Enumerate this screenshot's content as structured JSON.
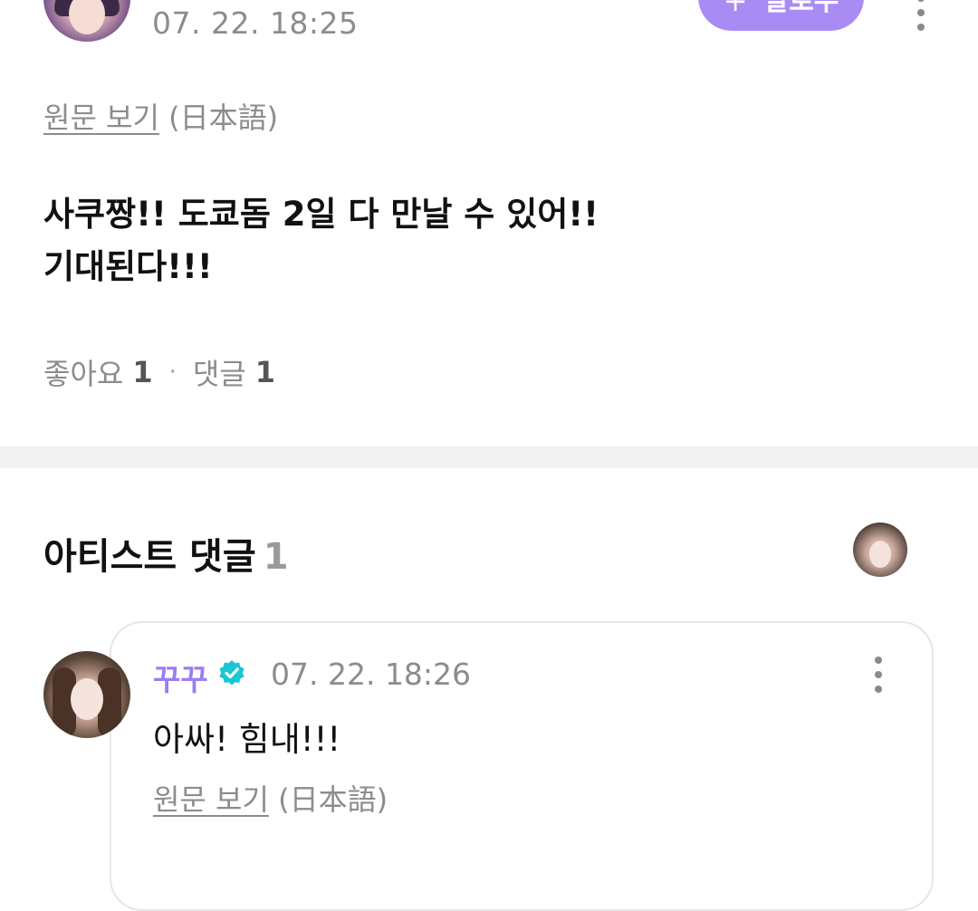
{
  "post": {
    "timestamp": "07. 22. 18:25",
    "follow_label": "팔로우",
    "follow_icon": "+",
    "view_original_label": "원문 보기",
    "original_language": "(日本語)",
    "body": "사쿠짱!! 도쿄돔 2일 다 만날 수 있어!!\n기대된다!!!",
    "likes_label": "좋아요",
    "likes_count": "1",
    "separator_dot": "·",
    "comments_label": "댓글",
    "comments_count": "1"
  },
  "artist_comments": {
    "title": "아티스트 댓글",
    "count": "1",
    "items": [
      {
        "author": "꾸꾸",
        "verified": true,
        "timestamp": "07. 22. 18:26",
        "body": "아싸! 힘내!!!",
        "view_original_label": "원문 보기",
        "original_language": "(日本語)"
      }
    ]
  },
  "icons": {
    "more": "more-vertical-icon",
    "verified": "verified-badge-icon"
  },
  "colors": {
    "accent": "#a88cf3",
    "artist_name": "#9c7cf4",
    "verified": "#19c6d6",
    "muted_text": "#8c8c8c",
    "separator": "#f2f2f3"
  }
}
